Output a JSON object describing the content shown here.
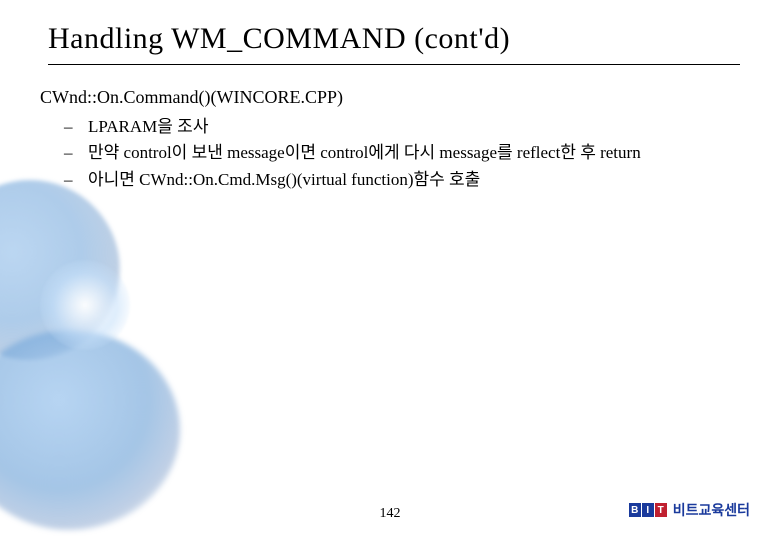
{
  "title": "Handling WM_COMMAND (cont'd)",
  "heading": "CWnd::On.Command()(WINCORE.CPP)",
  "bullets": [
    "LPARAM을 조사",
    "만약 control이 보낸 message이면 control에게 다시 message를 reflect한 후 return",
    "아니면 CWnd::On.Cmd.Msg()(virtual function)함수 호출"
  ],
  "page_number": "142",
  "footer": {
    "logo_letters": [
      "B",
      "I",
      "T"
    ],
    "brand_text": "비트교육센터"
  }
}
